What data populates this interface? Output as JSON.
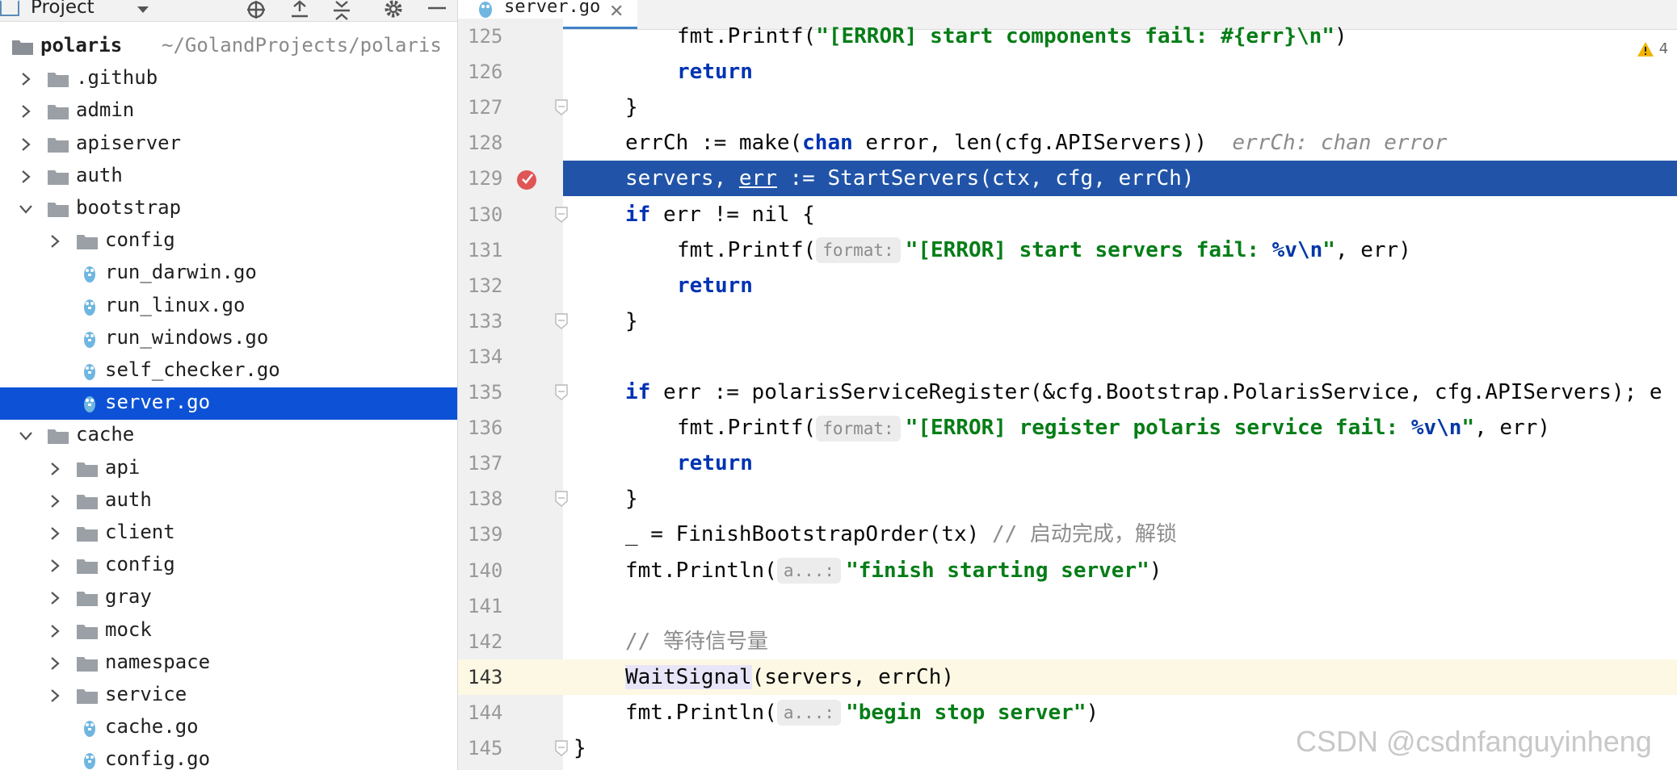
{
  "project": {
    "title": "Project",
    "tree": [
      {
        "label": "polaris",
        "path": "~/GolandProjects/polaris",
        "kind": "root-folder",
        "expanded": true
      },
      {
        "label": ".github",
        "kind": "folder",
        "expanded": false
      },
      {
        "label": "admin",
        "kind": "folder",
        "expanded": false
      },
      {
        "label": "apiserver",
        "kind": "folder",
        "expanded": false
      },
      {
        "label": "auth",
        "kind": "folder",
        "expanded": false
      },
      {
        "label": "bootstrap",
        "kind": "folder",
        "expanded": true
      },
      {
        "label": "config",
        "kind": "folder",
        "expanded": false
      },
      {
        "label": "run_darwin.go",
        "kind": "go-file"
      },
      {
        "label": "run_linux.go",
        "kind": "go-file"
      },
      {
        "label": "run_windows.go",
        "kind": "go-file"
      },
      {
        "label": "self_checker.go",
        "kind": "go-file"
      },
      {
        "label": "server.go",
        "kind": "go-file",
        "selected": true
      },
      {
        "label": "cache",
        "kind": "folder",
        "expanded": true
      },
      {
        "label": "api",
        "kind": "folder",
        "expanded": false
      },
      {
        "label": "auth",
        "kind": "folder",
        "expanded": false
      },
      {
        "label": "client",
        "kind": "folder",
        "expanded": false
      },
      {
        "label": "config",
        "kind": "folder",
        "expanded": false
      },
      {
        "label": "gray",
        "kind": "folder",
        "expanded": false
      },
      {
        "label": "mock",
        "kind": "folder",
        "expanded": false
      },
      {
        "label": "namespace",
        "kind": "folder",
        "expanded": false
      },
      {
        "label": "service",
        "kind": "folder",
        "expanded": false
      },
      {
        "label": "cache.go",
        "kind": "go-file"
      },
      {
        "label": "config.go",
        "kind": "go-file"
      }
    ]
  },
  "editor": {
    "tab_label": "server.go",
    "warning_count": "4",
    "lines": [
      {
        "n": "125",
        "parts": [
          {
            "t": "fmt.Printf(",
            "c": ""
          },
          {
            "t": "\"[ERROR] start components fail: #{err}\\n\"",
            "c": "str"
          },
          {
            "t": ")",
            "c": ""
          }
        ]
      },
      {
        "n": "126",
        "parts": [
          {
            "t": "return",
            "c": "kw"
          }
        ]
      },
      {
        "n": "127",
        "parts": [
          {
            "t": "}",
            "c": ""
          }
        ]
      },
      {
        "n": "128",
        "parts": [
          {
            "t": "errCh := make(",
            "c": ""
          },
          {
            "t": "chan",
            "c": "kw"
          },
          {
            "t": " error, len(cfg.APIServers))",
            "c": ""
          }
        ],
        "inlay": "errCh: chan error"
      },
      {
        "n": "129",
        "parts": [
          {
            "t": "servers, ",
            "c": ""
          },
          {
            "t": "err",
            "c": "ul"
          },
          {
            "t": " := StartServers(ctx, cfg, errCh)",
            "c": ""
          }
        ]
      },
      {
        "n": "130",
        "parts": [
          {
            "t": "if",
            "c": "kw"
          },
          {
            "t": " err != nil {",
            "c": ""
          }
        ]
      },
      {
        "n": "131",
        "parts": [
          {
            "t": "fmt.Printf(",
            "c": ""
          },
          {
            "t": "format:",
            "c": "hint"
          },
          {
            "t": "\"[ERROR] start servers fail: ",
            "c": "str"
          },
          {
            "t": "%v\\n",
            "c": "fmtv"
          },
          {
            "t": "\"",
            "c": "str"
          },
          {
            "t": ", err)",
            "c": ""
          }
        ]
      },
      {
        "n": "132",
        "parts": [
          {
            "t": "return",
            "c": "kw"
          }
        ]
      },
      {
        "n": "133",
        "parts": [
          {
            "t": "}",
            "c": ""
          }
        ]
      },
      {
        "n": "134",
        "parts": []
      },
      {
        "n": "135",
        "parts": [
          {
            "t": "if",
            "c": "kw"
          },
          {
            "t": " err := polarisServiceRegister(&cfg.Bootstrap.PolarisService, cfg.APIServers); e",
            "c": ""
          }
        ]
      },
      {
        "n": "136",
        "parts": [
          {
            "t": "fmt.Printf(",
            "c": ""
          },
          {
            "t": "format:",
            "c": "hint"
          },
          {
            "t": "\"[ERROR] register polaris service fail: ",
            "c": "str"
          },
          {
            "t": "%v\\n",
            "c": "fmtv"
          },
          {
            "t": "\"",
            "c": "str"
          },
          {
            "t": ", err)",
            "c": ""
          }
        ]
      },
      {
        "n": "137",
        "parts": [
          {
            "t": "return",
            "c": "kw"
          }
        ]
      },
      {
        "n": "138",
        "parts": [
          {
            "t": "}",
            "c": ""
          }
        ]
      },
      {
        "n": "139",
        "parts": [
          {
            "t": "_ = FinishBootstrapOrder(tx) ",
            "c": ""
          },
          {
            "t": "// 启动完成，解锁",
            "c": "cmt"
          }
        ]
      },
      {
        "n": "140",
        "parts": [
          {
            "t": "fmt.Println(",
            "c": ""
          },
          {
            "t": "a...:",
            "c": "hint"
          },
          {
            "t": "\"finish starting server\"",
            "c": "str"
          },
          {
            "t": ")",
            "c": ""
          }
        ]
      },
      {
        "n": "141",
        "parts": []
      },
      {
        "n": "142",
        "parts": [
          {
            "t": "// 等待信号量",
            "c": "cmt"
          }
        ]
      },
      {
        "n": "143",
        "parts": [
          {
            "t": "WaitSignal",
            "c": "wait"
          },
          {
            "t": "(servers, errCh)",
            "c": ""
          }
        ]
      },
      {
        "n": "144",
        "parts": [
          {
            "t": "fmt.Println(",
            "c": ""
          },
          {
            "t": "a...:",
            "c": "hint"
          },
          {
            "t": "\"begin stop server\"",
            "c": "str"
          },
          {
            "t": ")",
            "c": ""
          }
        ]
      },
      {
        "n": "145",
        "parts": [
          {
            "t": "}",
            "c": ""
          }
        ]
      }
    ]
  },
  "watermark": "CSDN @csdnfanguyinheng"
}
